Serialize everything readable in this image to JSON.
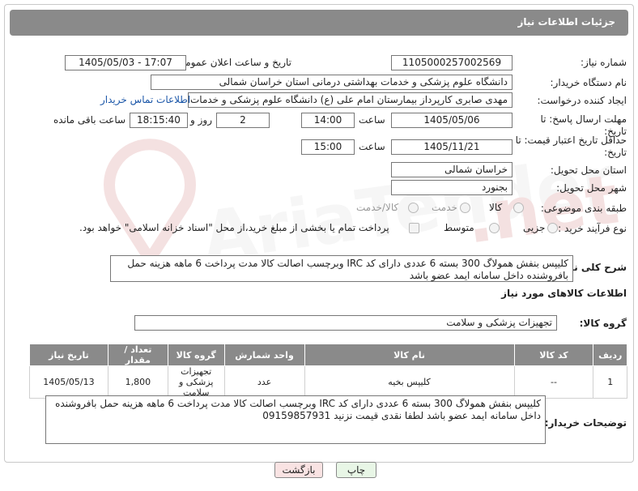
{
  "header": {
    "title": "جزئیات اطلاعات نیاز"
  },
  "fields": {
    "need_number": {
      "label": "شماره نیاز:",
      "value": "1105000257002569"
    },
    "announce": {
      "label": "تاریخ و ساعت اعلان عمومی:",
      "value": "1405/05/03 - 17:07"
    },
    "buyer_org": {
      "label": "نام دستگاه خریدار:",
      "value": "دانشگاه علوم پزشکی و خدمات بهداشتی درمانی استان خراسان شمالی"
    },
    "creator": {
      "label": "ایجاد کننده درخواست:",
      "value": "مهدی صابری کارپرداز بیمارستان امام علی (ع) دانشگاه علوم پزشکی و خدمات ب",
      "contact_link": "اطلاعات تماس خریدار"
    },
    "reply_deadline": {
      "label": "مهلت ارسال پاسخ: تا تاریخ:",
      "date": "1405/05/06",
      "time_label": "ساعت",
      "time": "14:00",
      "days": "2",
      "days_label": "روز و",
      "remaining": "18:15:40",
      "remaining_label": "ساعت باقی مانده"
    },
    "price_validity": {
      "label": "حداقل تاریخ اعتبار قیمت: تا تاریخ:",
      "date": "1405/11/21",
      "time_label": "ساعت",
      "time": "15:00"
    },
    "province": {
      "label": "استان محل تحویل:",
      "value": "خراسان شمالی"
    },
    "city": {
      "label": "شهر محل تحویل:",
      "value": "بجنورد"
    },
    "category": {
      "label": "طبقه بندی موضوعی:",
      "options": [
        "کالا",
        "خدمت",
        "کالا/خدمت"
      ]
    },
    "process": {
      "label": "نوع فرآیند خرید :",
      "options": [
        "جزیی",
        "متوسط"
      ],
      "treasury_note": "پرداخت تمام یا بخشی از مبلغ خرید،از محل \"اسناد خزانه اسلامی\" خواهد بود."
    }
  },
  "description": {
    "label": "شرح کلی نیاز:",
    "text": "کلیپس بنفش همولاگ 300 بسته 6 عددی دارای کد IRC وبرچسب اصالت کالا مدت پرداخت 6 ماهه هزینه حمل بافروشنده داخل سامانه ایمد عضو باشد"
  },
  "goods_info": {
    "title": "اطلاعات کالاهای مورد نیاز"
  },
  "goods_group": {
    "label": "گروه کالا:",
    "value": "تجهیزات پزشکی و سلامت"
  },
  "table": {
    "headers": [
      "ردیف",
      "کد کالا",
      "نام کالا",
      "واحد شمارش",
      "گروه کالا",
      "تعداد / مقدار",
      "تاریخ نیاز"
    ],
    "rows": [
      [
        "1",
        "--",
        "کلیپس بخیه",
        "عدد",
        "تجهیزات پزشکی و سلامت",
        "1,800",
        "1405/05/13"
      ]
    ]
  },
  "buyer_notes": {
    "label": "توضیحات خریدار:",
    "text": "کلیپس بنفش همولاگ 300 بسته 6 عددی دارای کد IRC وبرچسب اصالت کالا مدت پرداخت 6 ماهه هزینه حمل بافروشنده داخل سامانه ایمد عضو باشد لطفا نقدی قیمت نزنید 09159857931"
  },
  "buttons": {
    "print": "چاپ",
    "back": "بازگشت"
  },
  "colors": {
    "header_bg": "#8a8a8a",
    "link": "#1a56a8",
    "print_bg": "#e8f6e6",
    "back_bg": "#f9e3e3"
  }
}
